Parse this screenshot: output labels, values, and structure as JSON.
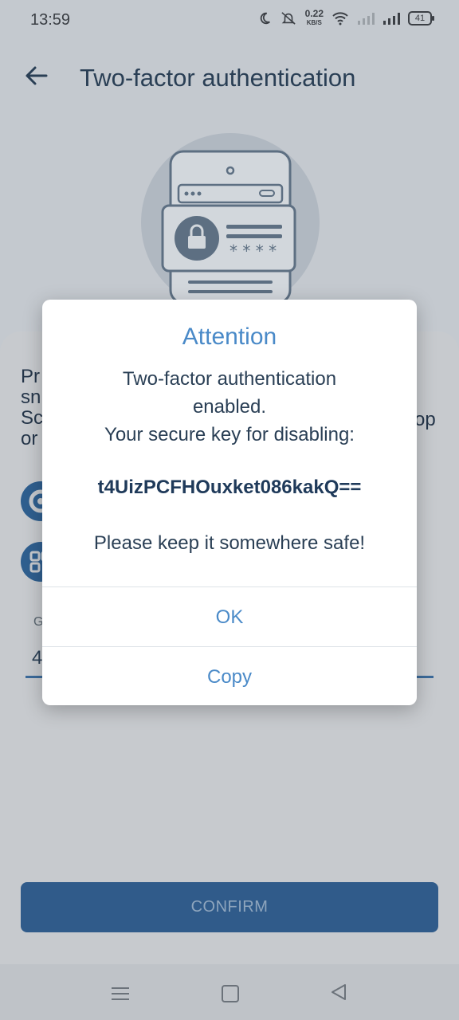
{
  "status_bar": {
    "time": "13:59",
    "net_speed": "0.22",
    "net_unit": "KB/S",
    "battery": "41"
  },
  "header": {
    "title": "Two-factor authentication"
  },
  "background": {
    "desc_lines": [
      "Pr",
      "sn",
      "Sc",
      "or"
    ],
    "desc_right": "op",
    "field_label": "G",
    "field_value": "4"
  },
  "confirm_label": "CONFIRM",
  "dialog": {
    "title": "Attention",
    "message_line1": "Two-factor authentication",
    "message_line2": "enabled.",
    "message_line3": "Your secure key for disabling:",
    "secure_key": "t4UizPCFHOuxket086kakQ==",
    "safe_note": "Please keep it somewhere safe!",
    "ok_label": "OK",
    "copy_label": "Copy"
  },
  "colors": {
    "accent": "#4a8ac8",
    "primary": "#305b8a",
    "scrim": "#c4c9cf"
  },
  "icons": [
    "back-arrow-icon",
    "phone-lock-illustration",
    "moon-icon",
    "mute-icon",
    "wifi-icon",
    "signal-icon",
    "battery-icon",
    "nav-menu-icon",
    "nav-home-icon",
    "nav-back-icon"
  ]
}
